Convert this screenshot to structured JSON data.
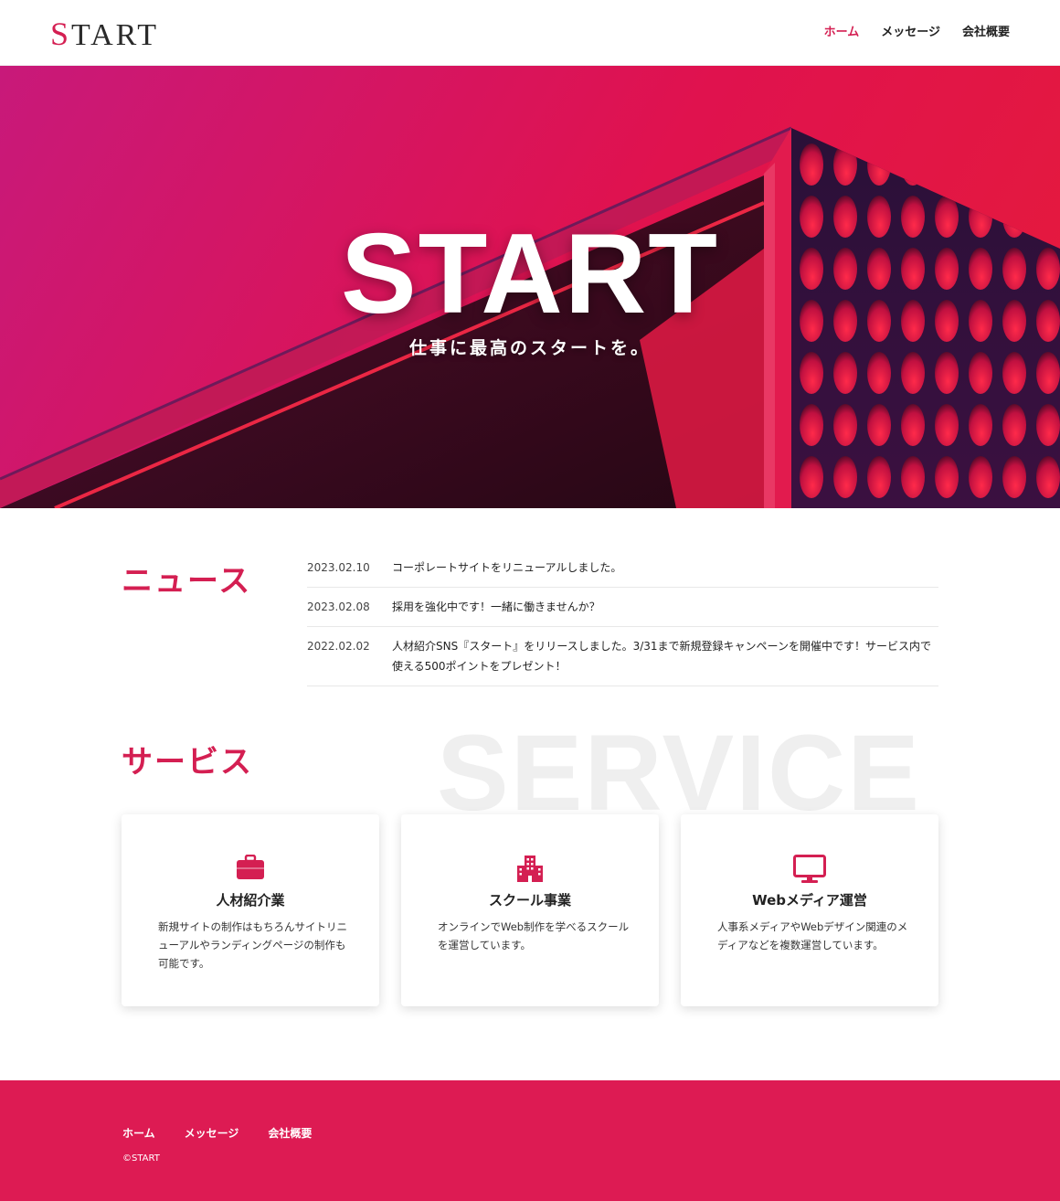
{
  "header": {
    "logo": "START",
    "nav": [
      {
        "label": "ホーム",
        "active": true
      },
      {
        "label": "メッセージ",
        "active": false
      },
      {
        "label": "会社概要",
        "active": false
      }
    ]
  },
  "hero": {
    "title": "START",
    "subtitle": "仕事に最高のスタートを。"
  },
  "news": {
    "heading": "ニュース",
    "items": [
      {
        "date": "2023.02.10",
        "text": "コーポレートサイトをリニューアルしました。"
      },
      {
        "date": "2023.02.08",
        "text": "採用を強化中です！一緒に働きませんか？"
      },
      {
        "date": "2022.02.02",
        "text": "人材紹介SNS『スタート』をリリースしました。3/31まで新規登録キャンペーンを開催中です！サービス内で使える500ポイントをプレゼント！"
      }
    ]
  },
  "service": {
    "heading": "サービス",
    "watermark": "SERVICE",
    "cards": [
      {
        "icon": "briefcase-icon",
        "title": "人材紹介業",
        "text": "新規サイトの制作はもちろんサイトリニューアルやランディングページの制作も可能です。"
      },
      {
        "icon": "building-icon",
        "title": "スクール事業",
        "text": "オンラインでWeb制作を学べるスクールを運営しています。"
      },
      {
        "icon": "monitor-icon",
        "title": "Webメディア運営",
        "text": "人事系メディアやWebデザイン関連のメディアなどを複数運営しています。"
      }
    ]
  },
  "footer": {
    "nav": [
      {
        "label": "ホーム"
      },
      {
        "label": "メッセージ"
      },
      {
        "label": "会社概要"
      }
    ],
    "copyright": "©START"
  },
  "colors": {
    "accent": "#d41f52",
    "footer_bg": "#dd1b53",
    "hero_gradient_start": "#c8197a",
    "hero_gradient_end": "#e51b3a"
  }
}
